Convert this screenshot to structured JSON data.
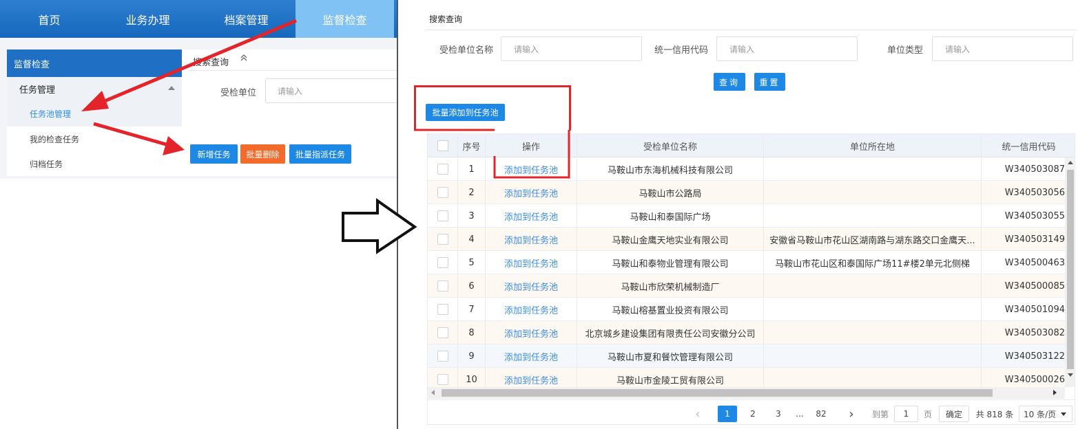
{
  "left": {
    "nav": [
      "首页",
      "业务办理",
      "档案管理",
      "监督检查"
    ],
    "sidebar": {
      "title": "监督检查",
      "group": "任务管理",
      "items": [
        "任务池管理",
        "我的检查任务",
        "归档任务"
      ]
    },
    "search": {
      "title": "搜索查询",
      "label": "受检单位",
      "placeholder": "请输入"
    },
    "buttons": {
      "new": "新增任务",
      "batch_delete": "批量删除",
      "batch_assign": "批量指派任务"
    }
  },
  "right": {
    "search": {
      "title": "搜索查询",
      "fields": [
        {
          "label": "受检单位名称",
          "placeholder": "请输入"
        },
        {
          "label": "统一信用代码",
          "placeholder": "请输入"
        },
        {
          "label": "单位类型",
          "placeholder": "请输入"
        }
      ],
      "query_label": "查询",
      "reset_label": "重置"
    },
    "batch_add_label": "批量添加到任务池",
    "table": {
      "headers": [
        "序号",
        "操作",
        "受检单位名称",
        "单位所在地",
        "统一信用代码"
      ],
      "rows": [
        {
          "no": "1",
          "op": "添加到任务池",
          "name": "马鞍山市东海机械科技有限公司",
          "addr": "",
          "code": "W340503087"
        },
        {
          "no": "2",
          "op": "添加到任务池",
          "name": "马鞍山市公路局",
          "addr": "",
          "code": "W340503056"
        },
        {
          "no": "3",
          "op": "添加到任务池",
          "name": "马鞍山和泰国际广场",
          "addr": "",
          "code": "W340503055"
        },
        {
          "no": "4",
          "op": "添加到任务池",
          "name": "马鞍山金鹰天地实业有限公司",
          "addr": "安徽省马鞍山市花山区湖南路与湖东路交口金鹰天...",
          "code": "W340503149"
        },
        {
          "no": "5",
          "op": "添加到任务池",
          "name": "马鞍山和泰物业管理有限公司",
          "addr": "马鞍山市花山区和泰国际广场11#楼2单元北侧梯",
          "code": "W340500463"
        },
        {
          "no": "6",
          "op": "添加到任务池",
          "name": "马鞍山市欣荣机械制造厂",
          "addr": "",
          "code": "W340500085"
        },
        {
          "no": "7",
          "op": "添加到任务池",
          "name": "马鞍山榕基置业投资有限公司",
          "addr": "",
          "code": "W340501094"
        },
        {
          "no": "8",
          "op": "添加到任务池",
          "name": "北京城乡建设集团有限责任公司安徽分公司",
          "addr": "",
          "code": "W340503082"
        },
        {
          "no": "9",
          "op": "添加到任务池",
          "name": "马鞍山市夏和餐饮管理有限公司",
          "addr": "",
          "code": "W340503122"
        },
        {
          "no": "10",
          "op": "添加到任务池",
          "name": "马鞍山市金陵工贸有限公司",
          "addr": "",
          "code": "W340500026"
        }
      ]
    },
    "pager": {
      "prev": "‹",
      "pages": [
        "1",
        "2",
        "3",
        "...",
        "82"
      ],
      "next": "›",
      "goto_label": "到第",
      "goto_value": "1",
      "page_suffix": "页",
      "confirm": "确定",
      "total": "共 818 条",
      "page_size": "10 条/页"
    }
  },
  "colors": {
    "primary": "#1e88e5",
    "danger": "#f36a2a",
    "annotation": "#e3242b"
  }
}
